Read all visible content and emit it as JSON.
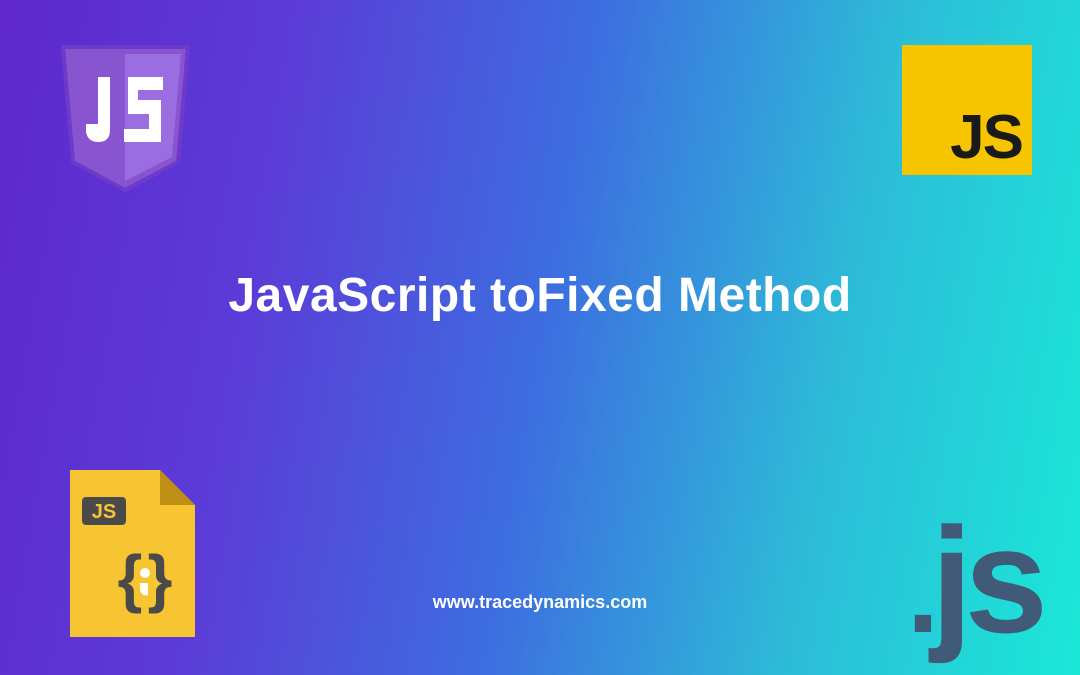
{
  "title": "JavaScript toFixed Method",
  "url": "www.tracedynamics.com",
  "icons": {
    "shield_text": "JS",
    "square_text": "JS",
    "file_badge": "JS",
    "dotjs": ".js"
  }
}
